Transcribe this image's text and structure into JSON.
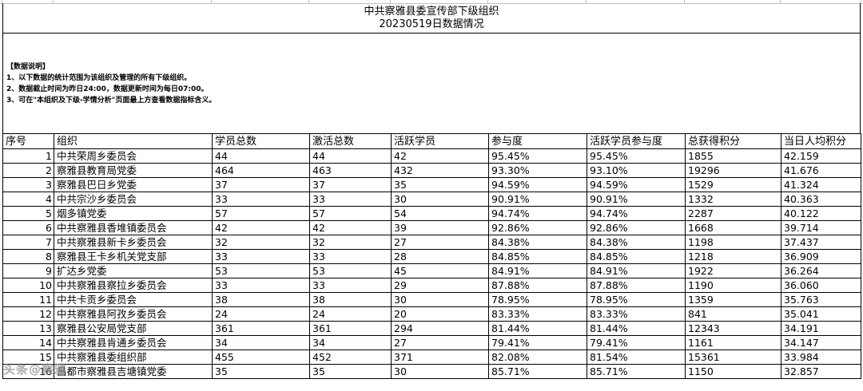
{
  "header": {
    "title": "中共察雅县委宣传部下级组织",
    "subtitle": "20230519日数据情况"
  },
  "notes": {
    "heading": "【数据说明】",
    "items": [
      "1、以下数据的统计范围为该组织及管理的所有下级组织。",
      "2、数据截止时间为昨日24:00，数据更新时间为每日07:00。",
      "3、可在\"本组织及下级-学情分析\"页面最上方查看数据指标含义。"
    ]
  },
  "table": {
    "columns": [
      "序号",
      "组织",
      "学员总数",
      "激活总数",
      "活跃学员",
      "参与度",
      "活跃学员参与度",
      "总获得积分",
      "当日人均积分"
    ],
    "rows": [
      [
        "1",
        "中共荣周乡委员会",
        "44",
        "44",
        "42",
        "95.45%",
        "95.45%",
        "1855",
        "42.159"
      ],
      [
        "2",
        "察雅县教育局党委",
        "464",
        "463",
        "432",
        "93.30%",
        "93.10%",
        "19296",
        "41.676"
      ],
      [
        "3",
        "察雅县巴日乡党委",
        "37",
        "37",
        "35",
        "94.59%",
        "94.59%",
        "1529",
        "41.324"
      ],
      [
        "4",
        "中共宗沙乡委员会",
        "33",
        "33",
        "30",
        "90.91%",
        "90.91%",
        "1332",
        "40.363"
      ],
      [
        "5",
        "烟多镇党委",
        "57",
        "57",
        "54",
        "94.74%",
        "94.74%",
        "2287",
        "40.122"
      ],
      [
        "6",
        "中共察雅县香堆镇委员会",
        "42",
        "42",
        "39",
        "92.86%",
        "92.86%",
        "1668",
        "39.714"
      ],
      [
        "7",
        "中共察雅县新卡乡委员会",
        "32",
        "32",
        "27",
        "84.38%",
        "84.38%",
        "1198",
        "37.437"
      ],
      [
        "8",
        "察雅县王卡乡机关党支部",
        "33",
        "33",
        "28",
        "84.85%",
        "84.85%",
        "1218",
        "36.909"
      ],
      [
        "9",
        "扩达乡党委",
        "53",
        "53",
        "45",
        "84.91%",
        "84.91%",
        "1922",
        "36.264"
      ],
      [
        "10",
        "中共察雅县察拉乡委员会",
        "33",
        "33",
        "29",
        "87.88%",
        "87.88%",
        "1190",
        "36.060"
      ],
      [
        "11",
        "中共卡贡乡委员会",
        "38",
        "38",
        "30",
        "78.95%",
        "78.95%",
        "1359",
        "35.763"
      ],
      [
        "12",
        "中共察雅县阿孜乡委员会",
        "24",
        "24",
        "20",
        "83.33%",
        "83.33%",
        "841",
        "35.041"
      ],
      [
        "13",
        "察雅县公安局党支部",
        "361",
        "361",
        "294",
        "81.44%",
        "81.44%",
        "12343",
        "34.191"
      ],
      [
        "14",
        "中共察雅县肯通乡委员会",
        "34",
        "34",
        "27",
        "79.41%",
        "79.41%",
        "1161",
        "34.147"
      ],
      [
        "15",
        "中共察雅县委组织部",
        "455",
        "452",
        "371",
        "82.08%",
        "81.54%",
        "15361",
        "33.984"
      ],
      [
        "16",
        "昌都市察雅县吉塘镇党委",
        "35",
        "35",
        "30",
        "85.71%",
        "85.71%",
        "1150",
        "32.857"
      ]
    ]
  },
  "watermark": "头条@察雅"
}
